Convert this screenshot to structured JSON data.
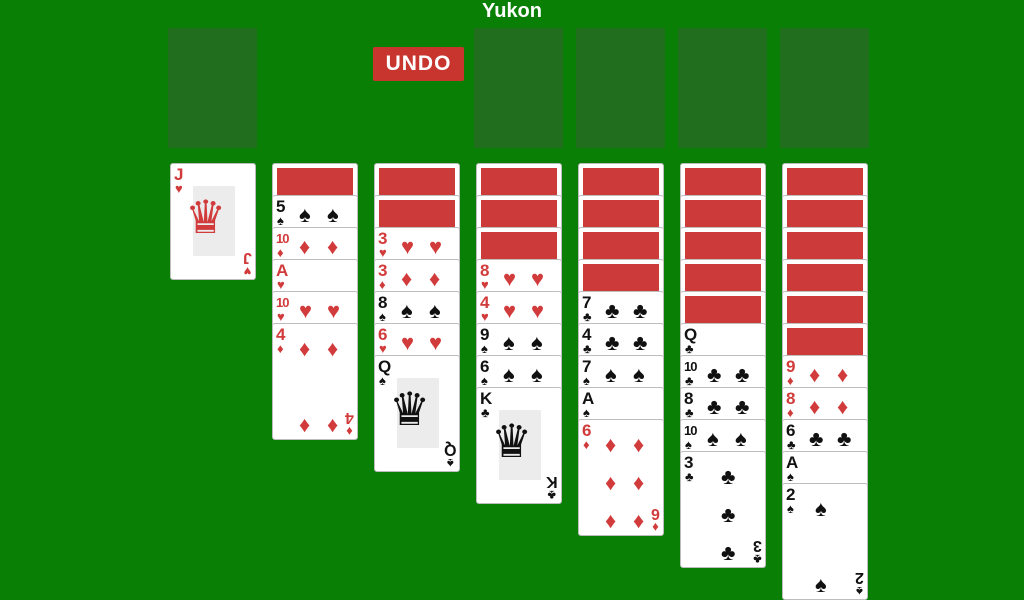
{
  "title": "Yukon",
  "undo_label": "UNDO",
  "colors": {
    "felt": "#0a7f06",
    "card_back": "#cd3a3a",
    "red_suit": "#d23b3b",
    "undo": "#c8352f"
  },
  "foundation_slots": 4,
  "tableau": [
    {
      "hidden": 0,
      "faceup": [
        {
          "rank": "J",
          "suit": "♥"
        }
      ]
    },
    {
      "hidden": 1,
      "faceup": [
        {
          "rank": "5",
          "suit": "♠"
        },
        {
          "rank": "10",
          "suit": "♦"
        },
        {
          "rank": "A",
          "suit": "♥"
        },
        {
          "rank": "10",
          "suit": "♥"
        },
        {
          "rank": "4",
          "suit": "♦"
        }
      ]
    },
    {
      "hidden": 2,
      "faceup": [
        {
          "rank": "3",
          "suit": "♥"
        },
        {
          "rank": "3",
          "suit": "♦"
        },
        {
          "rank": "8",
          "suit": "♠"
        },
        {
          "rank": "6",
          "suit": "♥"
        },
        {
          "rank": "Q",
          "suit": "♠"
        }
      ]
    },
    {
      "hidden": 3,
      "faceup": [
        {
          "rank": "8",
          "suit": "♥"
        },
        {
          "rank": "4",
          "suit": "♥"
        },
        {
          "rank": "9",
          "suit": "♠"
        },
        {
          "rank": "6",
          "suit": "♠"
        },
        {
          "rank": "K",
          "suit": "♣"
        }
      ]
    },
    {
      "hidden": 4,
      "faceup": [
        {
          "rank": "7",
          "suit": "♣"
        },
        {
          "rank": "4",
          "suit": "♣"
        },
        {
          "rank": "7",
          "suit": "♠"
        },
        {
          "rank": "A",
          "suit": "♠"
        },
        {
          "rank": "6",
          "suit": "♦"
        }
      ]
    },
    {
      "hidden": 5,
      "faceup": [
        {
          "rank": "Q",
          "suit": "♣"
        },
        {
          "rank": "10",
          "suit": "♣"
        },
        {
          "rank": "8",
          "suit": "♣"
        },
        {
          "rank": "10",
          "suit": "♠"
        },
        {
          "rank": "3",
          "suit": "♣"
        }
      ]
    },
    {
      "hidden": 6,
      "faceup": [
        {
          "rank": "9",
          "suit": "♦"
        },
        {
          "rank": "8",
          "suit": "♦"
        },
        {
          "rank": "6",
          "suit": "♣"
        },
        {
          "rank": "A",
          "suit": "♠"
        },
        {
          "rank": "2",
          "suit": "♠"
        }
      ]
    }
  ]
}
